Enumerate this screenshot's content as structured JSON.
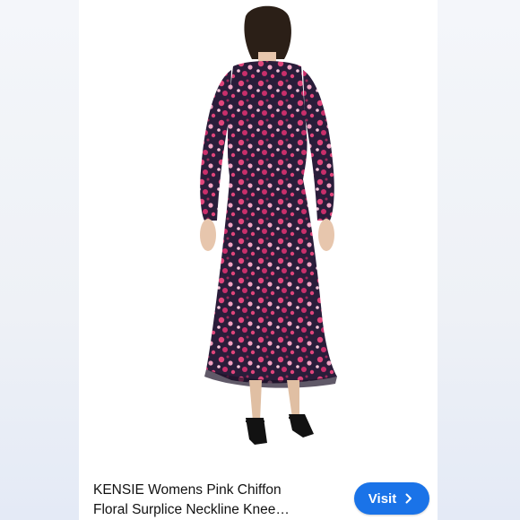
{
  "listing": {
    "title_line1": "KENSIE Womens Pink Chiffon",
    "title_line2": "Floral Surplice Neckline Knee…",
    "visit_label": "Visit"
  },
  "colors": {
    "accent": "#1a73e8",
    "dress_base": "#2a1d3a",
    "flower_pink": "#e0457b",
    "flower_light": "#f2a3c2"
  },
  "icons": {
    "visit": "chevron-right-icon"
  }
}
